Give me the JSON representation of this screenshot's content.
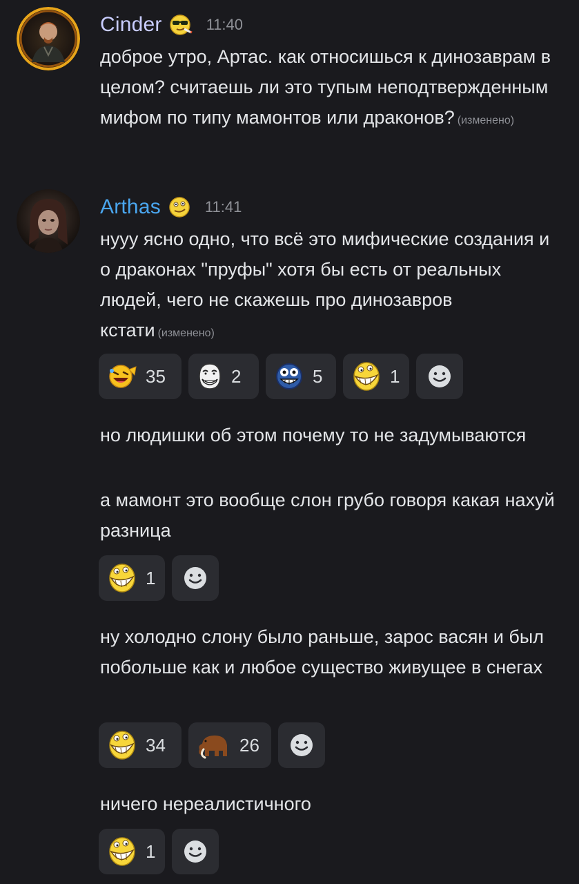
{
  "messages": [
    {
      "author": "Cinder",
      "author_color": "#c9cdff",
      "time": "11:40",
      "text": "доброе утро, Артас. как относишься к динозаврам в целом? считаешь ли это тупым неподтвержденным мифом по типу мамонтов или драконов?",
      "edited": "(изменено)"
    },
    {
      "author": "Arthas",
      "author_color": "#4aa6ef",
      "time": "11:41",
      "text": "нууу ясно одно, что всё это мифические создания и о драконах \"пруфы\" хотя бы есть от реальных людей, чего не скажешь про динозавров кстати",
      "edited": "(изменено)",
      "reactions": [
        {
          "icon": "laughing-face-icon",
          "count": "35"
        },
        {
          "icon": "troll-face-icon",
          "count": "2"
        },
        {
          "icon": "crazy-face-icon",
          "count": "5"
        },
        {
          "icon": "grin-face-icon",
          "count": "1"
        }
      ]
    },
    {
      "text": "но людишки об этом почему то не задумываются"
    },
    {
      "text": "а мамонт это вообще слон грубо говоря какая нахуй разница",
      "reactions": [
        {
          "icon": "grin-face-icon",
          "count": "1"
        }
      ]
    },
    {
      "text": "ну холодно слону было раньше, зарос васян и был побольше как и любое существо живущее в снегах",
      "reactions": [
        {
          "icon": "grin-face-icon",
          "count": "34"
        },
        {
          "icon": "mammoth-icon",
          "count": "26"
        }
      ]
    },
    {
      "text": "ничего нереалистичного",
      "reactions": [
        {
          "icon": "grin-face-icon",
          "count": "1"
        }
      ]
    }
  ]
}
